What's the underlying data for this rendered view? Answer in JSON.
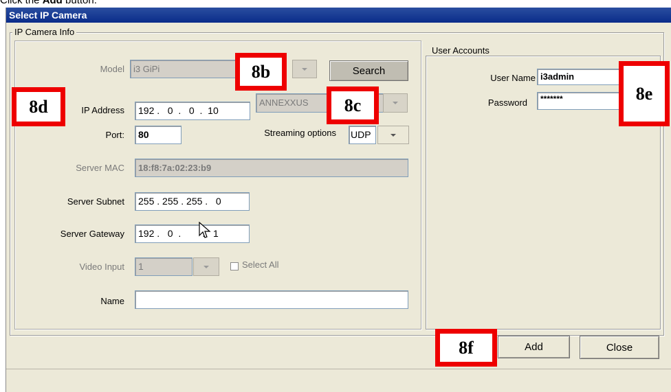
{
  "caption": {
    "prefix": "Click the ",
    "emphasis": "Add",
    "suffix": " button."
  },
  "window": {
    "title": "Select IP Camera"
  },
  "ip_camera_info": {
    "title": "IP Camera Info",
    "model_label": "Model",
    "model_value": "i3 GiPi",
    "search_label": "Search",
    "ip_label": "IP Address",
    "ip_value": "192 .   0  .   0  .  10",
    "adapter_value": "ANNEXXUS",
    "port_label": "Port:",
    "port_value": "80",
    "streaming_label": "Streaming options",
    "streaming_value": "UDP",
    "mac_label": "Server MAC",
    "mac_value": "18:f8:7a:02:23:b9",
    "subnet_label": "Server Subnet",
    "subnet_value": "255 . 255 . 255 .   0",
    "gateway_label": "Server Gateway",
    "gateway_value": "192 .   0  .        .   1",
    "video_label": "Video Input",
    "video_value": "1",
    "select_all_label": "Select All",
    "name_label": "Name",
    "name_value": ""
  },
  "user_accounts": {
    "title": "User Accounts",
    "username_label": "User Name",
    "username_value": "i3admin",
    "password_label": "Password",
    "password_value": "*******"
  },
  "buttons": {
    "add": "Add",
    "close": "Close"
  },
  "callouts": {
    "b": "8b",
    "c": "8c",
    "d": "8d",
    "e": "8e",
    "f": "8f"
  },
  "colors": {
    "callout_border": "#ee0000",
    "titlebar": "#0a2c8a",
    "dialog_bg": "#ece9d8"
  },
  "icons": [
    "dropdown-arrow-icon",
    "mouse-cursor-icon",
    "checkbox-icon"
  ]
}
